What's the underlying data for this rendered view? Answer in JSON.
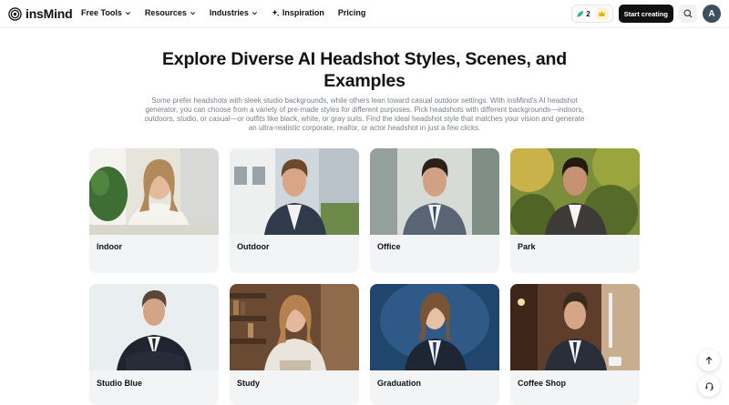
{
  "brand": {
    "name": "insMind"
  },
  "nav": {
    "items": [
      {
        "label": "Free Tools",
        "dropdown": true
      },
      {
        "label": "Resources",
        "dropdown": true
      },
      {
        "label": "Industries",
        "dropdown": true
      },
      {
        "label": "Inspiration",
        "dropdown": false,
        "icon": "sparkle-icon"
      },
      {
        "label": "Pricing",
        "dropdown": false
      }
    ],
    "credits": "2",
    "start_label": "Start creating",
    "avatar_initial": "A"
  },
  "hero": {
    "title": "Explore Diverse AI Headshot Styles, Scenes, and Examples",
    "description": "Some prefer headshots with sleek studio backgrounds, while others lean toward casual outdoor settings. With insMind's AI headshot generator, you can choose from a variety of pre-made styles for different purposes. Pick headshots with different backgrounds—indoors, outdoors, studio, or casual—or outfits like black, white, or gray suits. Find the ideal headshot style that matches your vision and generate an ultra-realistic corporate, realtor, or actor headshot in just a few clicks."
  },
  "styles": [
    {
      "label": "Indoor"
    },
    {
      "label": "Outdoor"
    },
    {
      "label": "Office"
    },
    {
      "label": "Park"
    },
    {
      "label": "Studio Blue"
    },
    {
      "label": "Study"
    },
    {
      "label": "Graduation"
    },
    {
      "label": "Coffee Shop"
    }
  ],
  "colors": {
    "accent": "#111111",
    "card_bg": "#f3f4f6",
    "muted_text": "#7a7f87",
    "credit_icon": "#2fb98a",
    "crown": "#f0a500"
  }
}
